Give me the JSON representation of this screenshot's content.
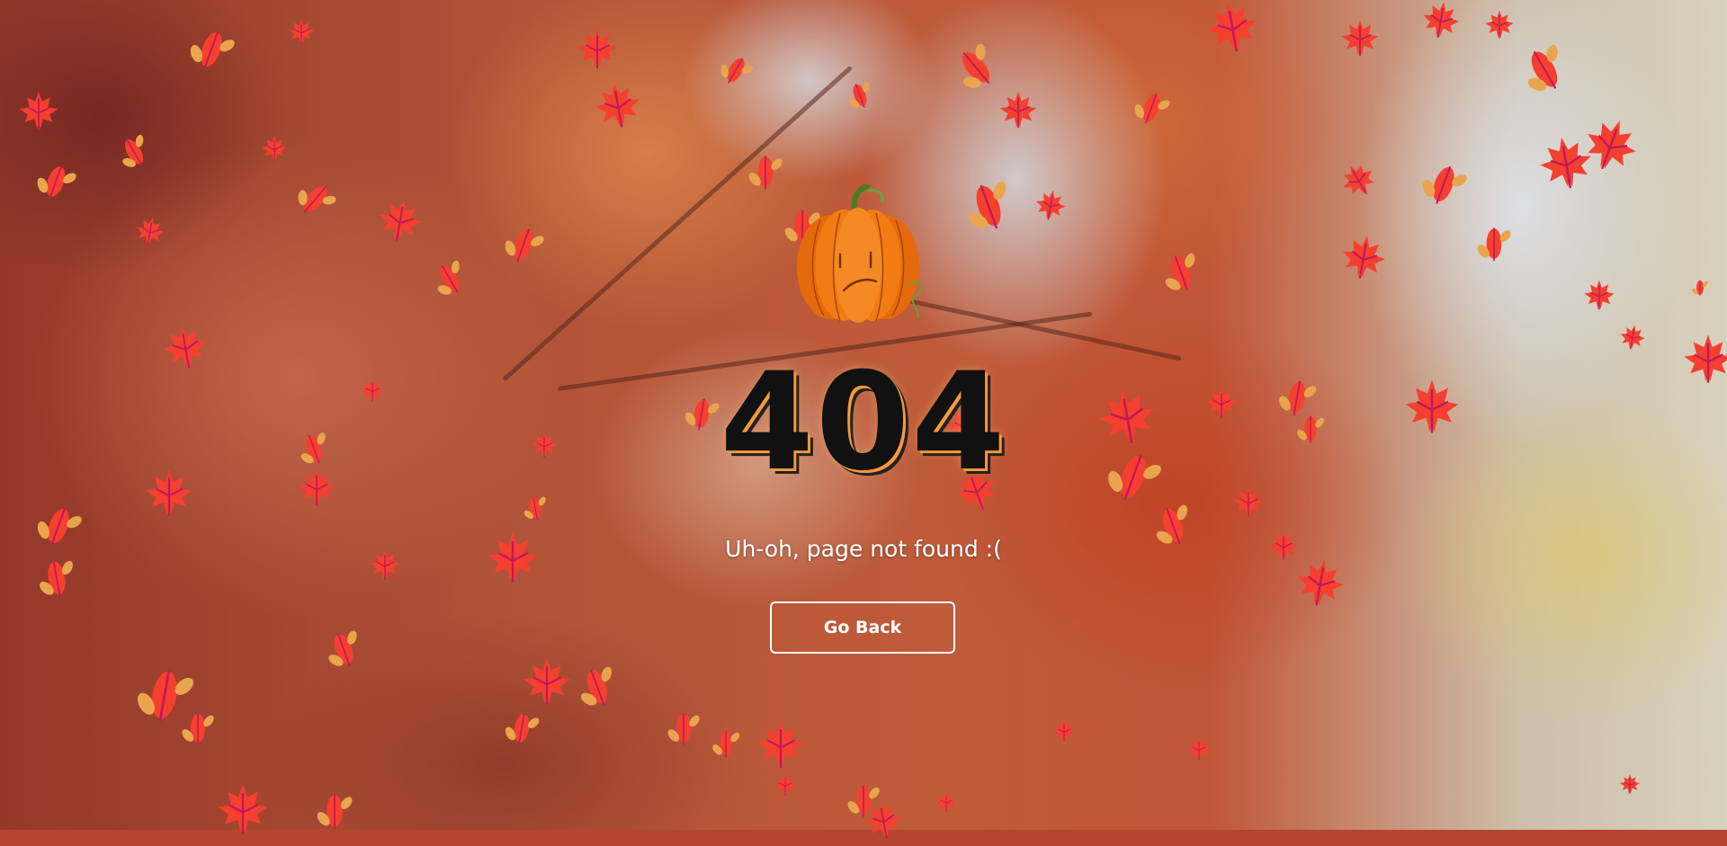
{
  "error": {
    "code": "404",
    "message": "Uh-oh, page not found :("
  },
  "actions": {
    "back_label": "Go Back"
  },
  "decor": {
    "pumpkin_icon": "sad-pumpkin-icon",
    "leaf_icons": [
      "maple-leaf-icon",
      "oval-leaf-icon"
    ],
    "colors": {
      "leaf_red": "#f5402f",
      "leaf_orange": "#e8a54e",
      "leaf_vein": "#c2185b",
      "pumpkin": "#f27b13",
      "text": "#ffffff",
      "code_text": "#111111"
    }
  }
}
